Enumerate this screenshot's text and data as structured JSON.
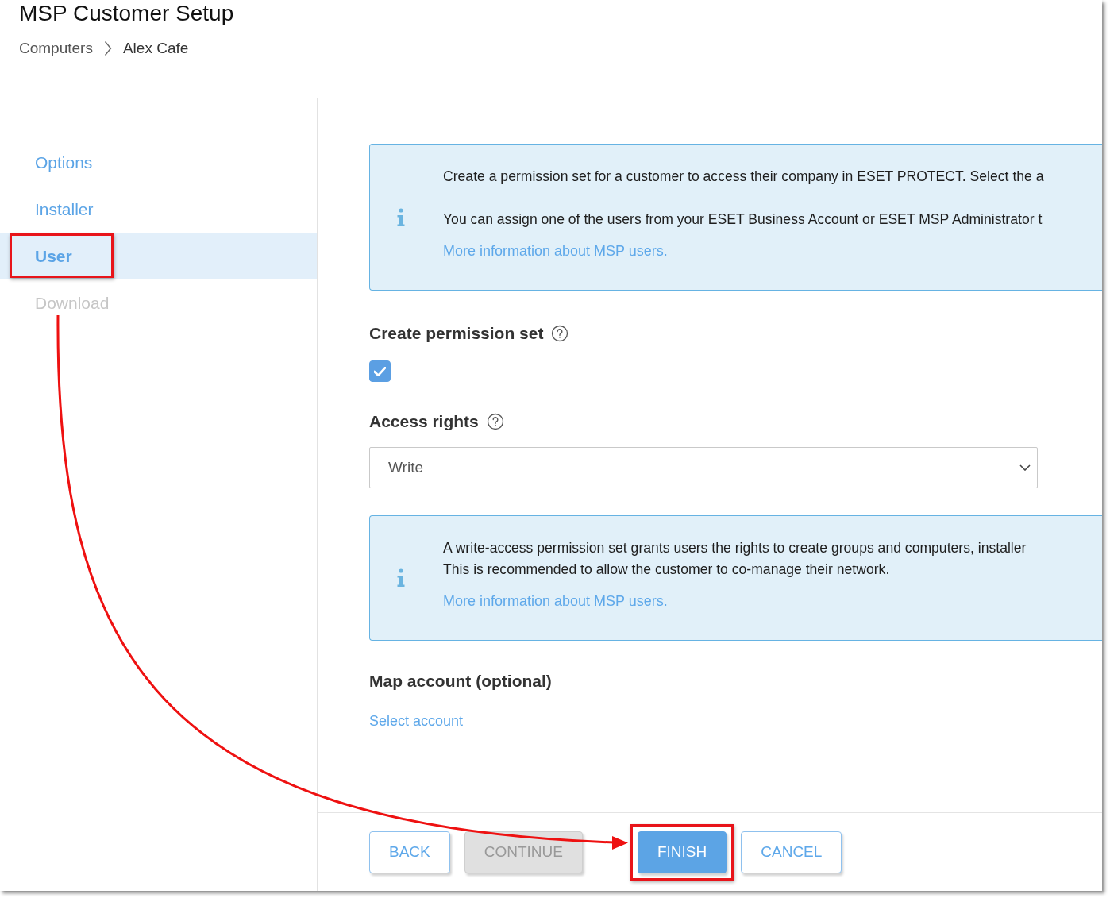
{
  "header": {
    "title": "MSP Customer Setup",
    "breadcrumb": [
      {
        "label": "Computers",
        "link": true
      },
      {
        "label": "Alex Cafe",
        "link": false
      }
    ]
  },
  "sidebar": {
    "items": [
      {
        "label": "Options",
        "selected": false,
        "disabled": false,
        "highlighted": false
      },
      {
        "label": "Installer",
        "selected": false,
        "disabled": false,
        "highlighted": false
      },
      {
        "label": "User",
        "selected": true,
        "disabled": false,
        "highlighted": true
      },
      {
        "label": "Download",
        "selected": false,
        "disabled": true,
        "highlighted": false
      }
    ]
  },
  "intro_notice": {
    "paragraphs": [
      [
        "Create a permission set for a customer to access their company in ESET PROTECT. Select the a"
      ],
      [
        "You can assign one of the users from your ESET Business Account or ESET MSP Administrator t"
      ]
    ],
    "link": "More information about MSP users."
  },
  "permission_set": {
    "label": "Create permission set",
    "checked": true
  },
  "access_rights": {
    "label": "Access rights",
    "value": "Write"
  },
  "access_notice": {
    "paragraphs": [
      [
        "A write-access permission set grants users the rights to create groups and computers, installer",
        "This is recommended to allow the customer to co-manage their network."
      ]
    ],
    "link": "More information about MSP users."
  },
  "map_account": {
    "label": "Map account (optional)",
    "link": "Select account"
  },
  "buttons": [
    {
      "label": "BACK",
      "kind": "secondary",
      "disabled": false,
      "highlighted": false
    },
    {
      "label": "CONTINUE",
      "kind": "secondary",
      "disabled": true,
      "highlighted": false
    },
    {
      "label": "FINISH",
      "kind": "primary",
      "disabled": false,
      "highlighted": true
    },
    {
      "label": "CANCEL",
      "kind": "secondary",
      "disabled": false,
      "highlighted": false
    }
  ]
}
